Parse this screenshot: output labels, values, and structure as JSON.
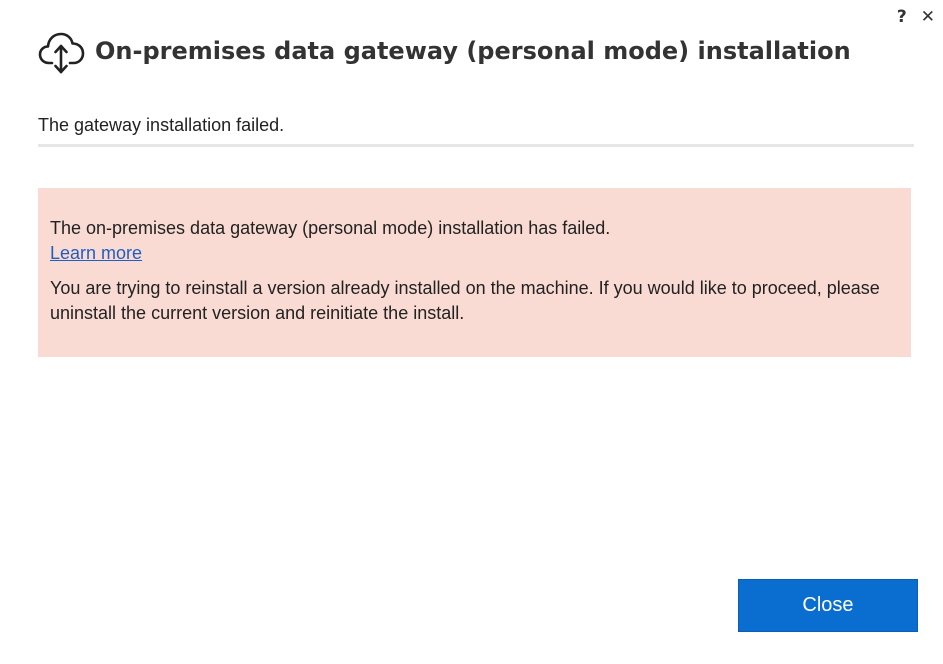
{
  "window": {
    "help_label": "?",
    "close_label": "✕",
    "title": "On-premises data gateway (personal mode) installation",
    "logo_icon": "cloud-upload-icon"
  },
  "status": {
    "text": "The gateway installation failed."
  },
  "error": {
    "message": "The on-premises data gateway (personal mode) installation has failed.",
    "learn_more": "Learn more",
    "detail": "You are trying to reinstall a version already installed on the machine. If you would like to proceed, please uninstall the current version and reinitiate the install.",
    "background_color": "#f9dbd3",
    "link_color": "#1f5fc4"
  },
  "footer": {
    "close_button_label": "Close",
    "button_color": "#0a6ed1"
  }
}
